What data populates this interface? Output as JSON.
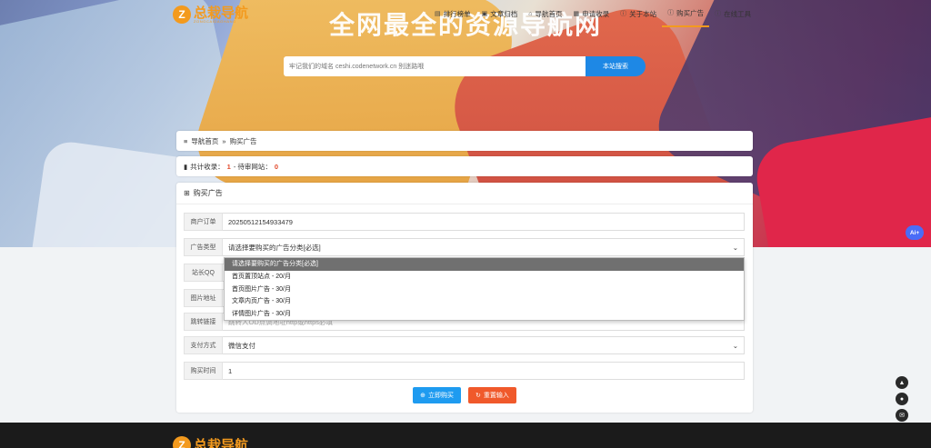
{
  "brand": {
    "name": "总栽导航",
    "sub": "ZONGCAIDAOHANG",
    "mark": "Z",
    "color": "#f39a1e"
  },
  "nav": {
    "items": [
      {
        "label": "排行榜单",
        "icon": "ranking-icon"
      },
      {
        "label": "文章归档",
        "icon": "archive-icon"
      },
      {
        "label": "导航首页",
        "icon": "home-icon"
      },
      {
        "label": "申请收录",
        "icon": "apply-icon"
      },
      {
        "label": "关于本站",
        "icon": "info-icon"
      },
      {
        "label": "购买广告",
        "icon": "info-icon",
        "active": true
      },
      {
        "label": "在线工具",
        "icon": "info-icon"
      }
    ]
  },
  "hero": {
    "title": "全网最全的资源导航网"
  },
  "search": {
    "placeholder": "牢记我们的域名 ceshi.codenetwork.cn 别迷路哦",
    "button": "本站搜索"
  },
  "breadcrumb": {
    "home": "导航首页",
    "sep": "»",
    "current": "购买广告"
  },
  "stats": {
    "label1": "共计收录：",
    "count1": "1",
    "label2": " - 待审网站：",
    "count2": "0"
  },
  "form": {
    "title": "购买广告",
    "order_label": "商户订单",
    "order_value": "20250512154933479",
    "type_label": "广告类型",
    "type_value": "请选择要购买的广告分类[必选]",
    "qq_label": "站长QQ",
    "img_label": "图片地址",
    "link_label": "跳转链接",
    "link_placeholder": "跳转人OD点调地址http或https必填",
    "pay_label": "支付方式",
    "pay_value": "微信支付",
    "time_label": "购买时间",
    "time_value": "1",
    "submit": "立即购买",
    "reset": "重置输入"
  },
  "dropdown": {
    "options": [
      "请选择要购买的广告分类[必选]",
      "首页置顶站点 - 20/月",
      "首页图片广告 - 30/月",
      "文章内页广告 - 30/月",
      "详情图片广告 - 30/月"
    ]
  },
  "side": {
    "up": "▲",
    "bell": "●",
    "mail": "✉",
    "ai": "Ai+"
  }
}
